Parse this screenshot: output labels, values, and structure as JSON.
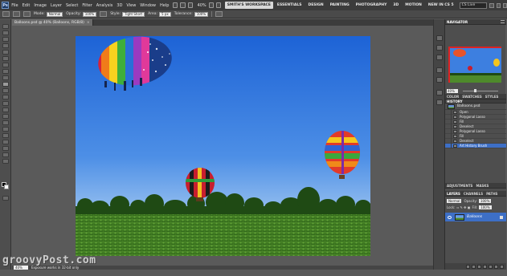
{
  "app": {
    "logo": "Ps",
    "menu": [
      "File",
      "Edit",
      "Image",
      "Layer",
      "Select",
      "Filter",
      "Analysis",
      "3D",
      "View",
      "Window",
      "Help"
    ],
    "zoom": "40%",
    "workspaces": [
      "SMITH'S WORKSPACE",
      "ESSENTIALS",
      "DESIGN",
      "PAINTING",
      "PHOTOGRAPHY",
      "3D",
      "MOTION",
      "NEW IN CS 5"
    ],
    "cs_live": "CS Live"
  },
  "options": {
    "mode_label": "Mode:",
    "mode_value": "Normal",
    "opacity_label": "Opacity:",
    "opacity_value": "100%",
    "style_label": "Style:",
    "style_value": "Tight Short",
    "area_label": "Area:",
    "area_value": "5 px",
    "tolerance_label": "Tolerance:",
    "tolerance_value": "100%"
  },
  "document": {
    "tab_title": "Balloons.psd @ 40% (Balloons, RGB/8)",
    "close": "×"
  },
  "statusbar": {
    "zoom": "40%",
    "info": "Exposure works in 32-bit only"
  },
  "panels": {
    "navigator": {
      "title": "NAVIGATOR",
      "zoom": "40%"
    },
    "history_tabs": [
      "COLOR",
      "SWATCHES",
      "STYLES"
    ],
    "history": {
      "title": "HISTORY",
      "snapshot": "Balloons.psd",
      "items": [
        "Open",
        "Polygonal Lasso",
        "Fill",
        "Deselect",
        "Polygonal Lasso",
        "Fill",
        "Deselect",
        "Art History Brush"
      ],
      "selected_index": 7
    },
    "adjust_tabs": [
      "ADJUSTMENTS",
      "MASKS"
    ],
    "layers": {
      "tabs": [
        "LAYERS",
        "CHANNELS",
        "PATHS"
      ],
      "blend": "Normal",
      "opacity_label": "Opacity:",
      "opacity": "100%",
      "lock_label": "Lock:",
      "fill_label": "Fill:",
      "fill": "100%",
      "layer_name": "Balloons"
    }
  },
  "watermark": "groovyPost.com",
  "colors": {
    "accent": "#3d6fc6",
    "app_bg": "#5a5a5a",
    "menubar": "#3b3b3b",
    "panel": "#4e4e4e"
  }
}
